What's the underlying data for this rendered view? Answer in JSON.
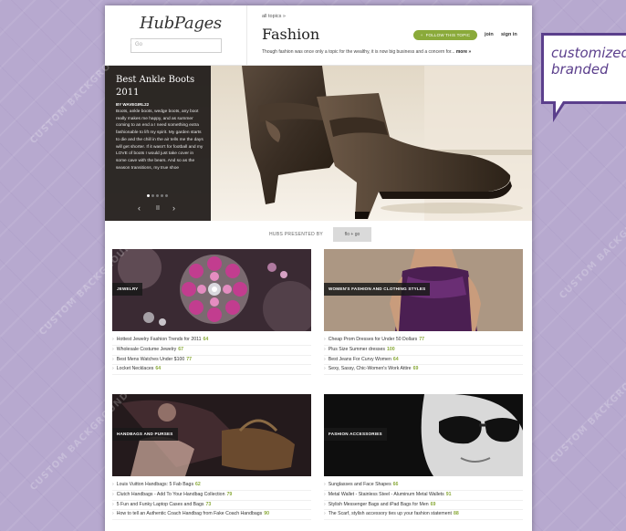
{
  "site": {
    "logo": "HubPages",
    "search_placeholder": "Go"
  },
  "topic": {
    "breadcrumb": "all topics  »",
    "title": "Fashion",
    "follow_label": "FOLLOW THIS TOPIC",
    "join_label": "join",
    "signin_label": "sign in",
    "description": "Though fashion was once only a topic for the wealthy, it is now big business and a concern for...",
    "more_label": "more »"
  },
  "hero": {
    "title": "Best Ankle Boots 2011",
    "author": "BY WAVEGIRL22",
    "excerpt": "Boots, ankle boots, wedge boots, any boot really makes me happy, and as summer coming to an end a I need something extra fashionable to lift my spirit. My garden starts to die and the chill in the air tells me the days will get shorter. If it wasn't for football and my LOVE of boots I would just take cover in some cave with the bears. And so as the season transitions, my true shoe",
    "dots": 5,
    "active_dot": 0,
    "prev_icon": "‹",
    "pause_icon": "II",
    "next_icon": "›"
  },
  "sponsor": {
    "presented_by": "HUBS PRESENTED BY",
    "name": "flo + go"
  },
  "categories": [
    {
      "label": "JEWELRY",
      "items": [
        {
          "text": "Hottest Jewelry Fashion Trends for 2011",
          "count": "64"
        },
        {
          "text": "Wholesale Costume Jewelry",
          "count": "67"
        },
        {
          "text": "Best Mens Watches Under $100",
          "count": "77"
        },
        {
          "text": "Locket Necklaces",
          "count": "64"
        }
      ]
    },
    {
      "label": "WOMEN'S FASHION AND CLOTHING STYLES",
      "items": [
        {
          "text": "Cheap Prom Dresses for Under 50 Dollars",
          "count": "77"
        },
        {
          "text": "Plus Size Summer dresses",
          "count": "100"
        },
        {
          "text": "Best Jeans For Curvy Women",
          "count": "64"
        },
        {
          "text": "Sexy, Sassy, Chic-Women's Work Attire",
          "count": "69"
        }
      ]
    },
    {
      "label": "HANDBAGS AND PURSES",
      "items": [
        {
          "text": "Louis Vuitton Handbags: 5 Fab Bags",
          "count": "62"
        },
        {
          "text": "Clutch Handbags - Add To Your Handbag Collection",
          "count": "79"
        },
        {
          "text": "5 Fun and Funky Laptop Cases and Bags",
          "count": "73"
        },
        {
          "text": "How to tell an Authentic Coach Handbag from Fake Coach Handbags",
          "count": "90"
        }
      ]
    },
    {
      "label": "FASHION ACCESSORIES",
      "items": [
        {
          "text": "Sunglasses and Face Shapes",
          "count": "66"
        },
        {
          "text": "Metal Wallet - Stainless Steel - Aluminum Metal Wallets",
          "count": "91"
        },
        {
          "text": "Stylish Messenger Bags and iPad Bags for Men",
          "count": "69"
        },
        {
          "text": "The Scarf, stylish accessory ties up your fashion statement",
          "count": "88"
        }
      ]
    }
  ],
  "callout": {
    "text": "customized branded"
  },
  "watermark": "CUSTOM BACKGROUND ON",
  "colors": {
    "accent_green": "#8aaa3a",
    "callout_purple": "#5b3f8c",
    "background": "#b7a9cf"
  }
}
